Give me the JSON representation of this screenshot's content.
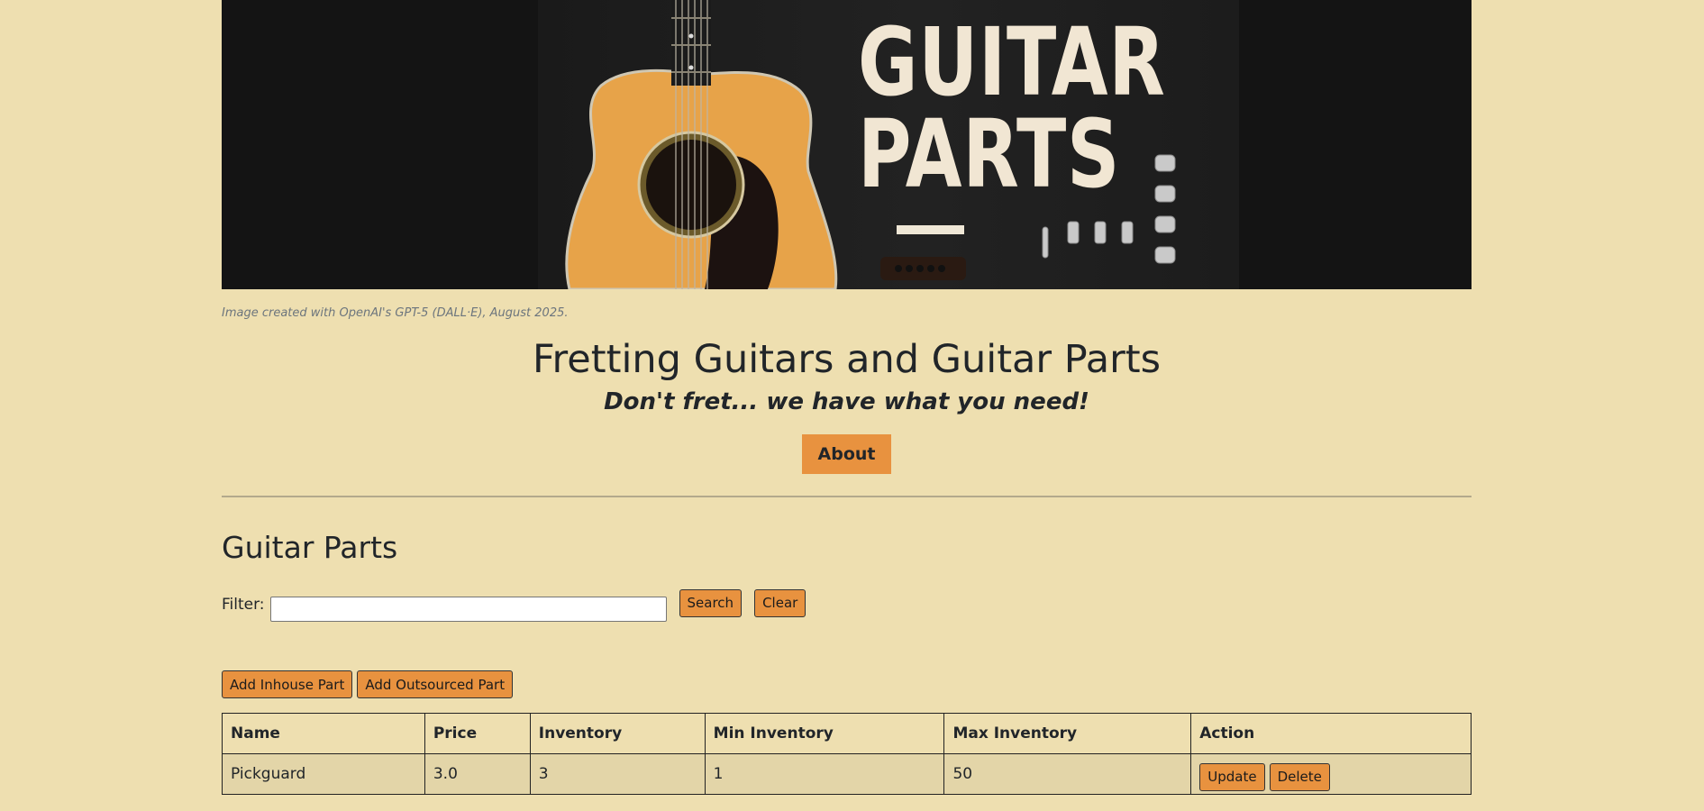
{
  "hero": {
    "title_line1": "GUITAR",
    "title_line2": "PARTS",
    "caption": "Image created with OpenAI's GPT-5 (DALL·E), August 2025."
  },
  "header": {
    "title": "Fretting Guitars and Guitar Parts",
    "tagline": "Don't fret... we have what you need!",
    "about_label": "About"
  },
  "parts_section": {
    "title": "Guitar Parts",
    "filter_label": "Filter:",
    "filter_value": "",
    "search_label": "Search",
    "clear_label": "Clear",
    "add_inhouse_label": "Add Inhouse Part",
    "add_outsourced_label": "Add Outsourced Part",
    "columns": [
      "Name",
      "Price",
      "Inventory",
      "Min Inventory",
      "Max Inventory",
      "Action"
    ],
    "rows": [
      {
        "name": "Pickguard",
        "price": "3.0",
        "inventory": "3",
        "min": "1",
        "max": "50",
        "update_label": "Update",
        "delete_label": "Delete"
      }
    ]
  },
  "colors": {
    "page_background": "#eedfb0",
    "accent_button": "#e8923f",
    "guitar_body": "#e7a349"
  }
}
